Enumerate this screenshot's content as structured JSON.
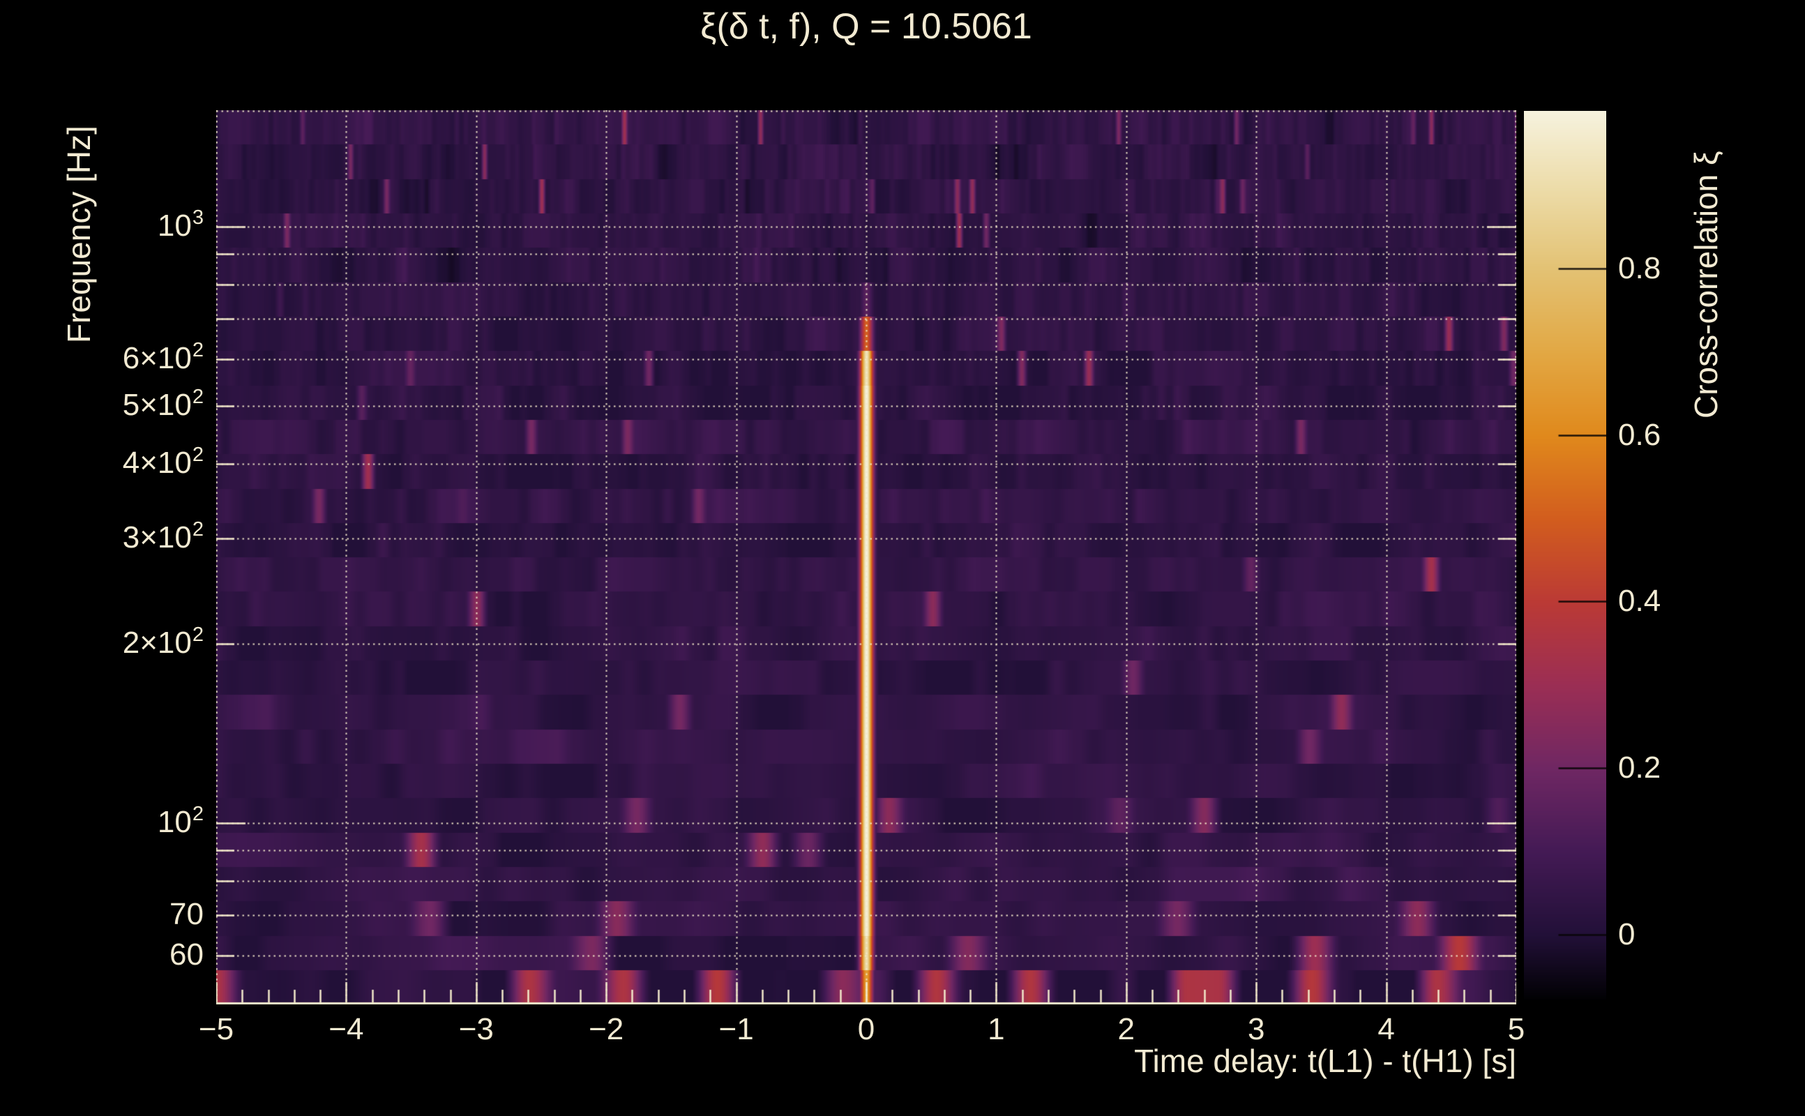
{
  "page": {
    "background_color": "#000000",
    "text_color": "#f2ead2"
  },
  "chart_data": {
    "type": "heatmap",
    "title": "ξ(δ t, f), Q = 10.5061",
    "q_value": 10.5061,
    "xlabel": "Time delay: t(L1) - t(H1) [s]",
    "ylabel": "Frequency [Hz]",
    "colorbar_label": "Cross-correlation ξ",
    "x_axis": {
      "range_s": [
        -5,
        5
      ],
      "major_tick_step_s": 1,
      "minor_tick_step_s": 0.2,
      "tick_labels": [
        "−5",
        "−4",
        "−3",
        "−2",
        "−1",
        "0",
        "1",
        "2",
        "3",
        "4",
        "5"
      ],
      "grid": "dotted vertical line at every integer"
    },
    "y_axis": {
      "scale": "log",
      "range_hz": [
        49.6,
        1568
      ],
      "gridline_freqs_hz": [
        1000,
        900,
        800,
        700,
        600,
        500,
        400,
        300,
        200,
        100,
        90,
        80,
        70,
        60
      ],
      "major_freqs_hz": [
        1000,
        100
      ],
      "tick_labels": [
        {
          "hz": 1000,
          "base": "10",
          "exp": "3"
        },
        {
          "hz": 600,
          "prefix": "6×",
          "base": "10",
          "exp": "2"
        },
        {
          "hz": 500,
          "prefix": "5×",
          "base": "10",
          "exp": "2"
        },
        {
          "hz": 400,
          "prefix": "4×",
          "base": "10",
          "exp": "2"
        },
        {
          "hz": 300,
          "prefix": "3×",
          "base": "10",
          "exp": "2"
        },
        {
          "hz": 200,
          "prefix": "2×",
          "base": "10",
          "exp": "2"
        },
        {
          "hz": 100,
          "base": "10",
          "exp": "2"
        },
        {
          "hz": 70,
          "text": "70"
        },
        {
          "hz": 60,
          "text": "60"
        }
      ]
    },
    "colorbar": {
      "value_range": [
        -0.078,
        0.989
      ],
      "ticks": [
        {
          "value": 0.8,
          "label": "0.8"
        },
        {
          "value": 0.6,
          "label": "0.6"
        },
        {
          "value": 0.4,
          "label": "0.4"
        },
        {
          "value": 0.2,
          "label": "0.2"
        },
        {
          "value": 0.0,
          "label": "0"
        }
      ],
      "colormap_name": "magma-like (black – purple – crimson – orange – cream)",
      "colormap_stops": [
        [
          0.0,
          "#010103"
        ],
        [
          0.073,
          "#221038"
        ],
        [
          0.167,
          "#441a55"
        ],
        [
          0.26,
          "#6f2763"
        ],
        [
          0.354,
          "#9b2e54"
        ],
        [
          0.448,
          "#bb3a35"
        ],
        [
          0.541,
          "#d25d1e"
        ],
        [
          0.635,
          "#e0891c"
        ],
        [
          0.729,
          "#e2a844"
        ],
        [
          0.823,
          "#e3c274"
        ],
        [
          0.917,
          "#edddab"
        ],
        [
          1.0,
          "#f6f2de"
        ]
      ]
    },
    "grid_style": {
      "style": "dotted",
      "color": "#f2e8ca"
    },
    "features": {
      "central_ridge": {
        "time_delay_s": 0.0,
        "freq_span_hz": [
          50,
          780
        ],
        "peak_xi": 0.985,
        "core_width_s": 0.03,
        "description": "narrow vertical ridge of near-total correlation at zero time delay, white-hot core from ~60–580 Hz fading to orange then dim pink above ~640 Hz"
      },
      "background": {
        "mean_xi": 0.04,
        "fluctuation_xi": 0.05,
        "description": "dark purple noise field with faint vertical tile striations; tile width grows toward low frequency"
      },
      "bottom_band": {
        "freq_span_hz": [
          49.6,
          56
        ],
        "description": "coarse time tiles alternating near-black and purple with scattered mildly-correlated pink blocks",
        "hot_tile_times_s": [
          -4.9,
          -2.5,
          -1.95,
          -1.05,
          0.5,
          1.3,
          2.37,
          2.6,
          3.4,
          4.35
        ],
        "hot_tile_xi": 0.38
      }
    }
  }
}
